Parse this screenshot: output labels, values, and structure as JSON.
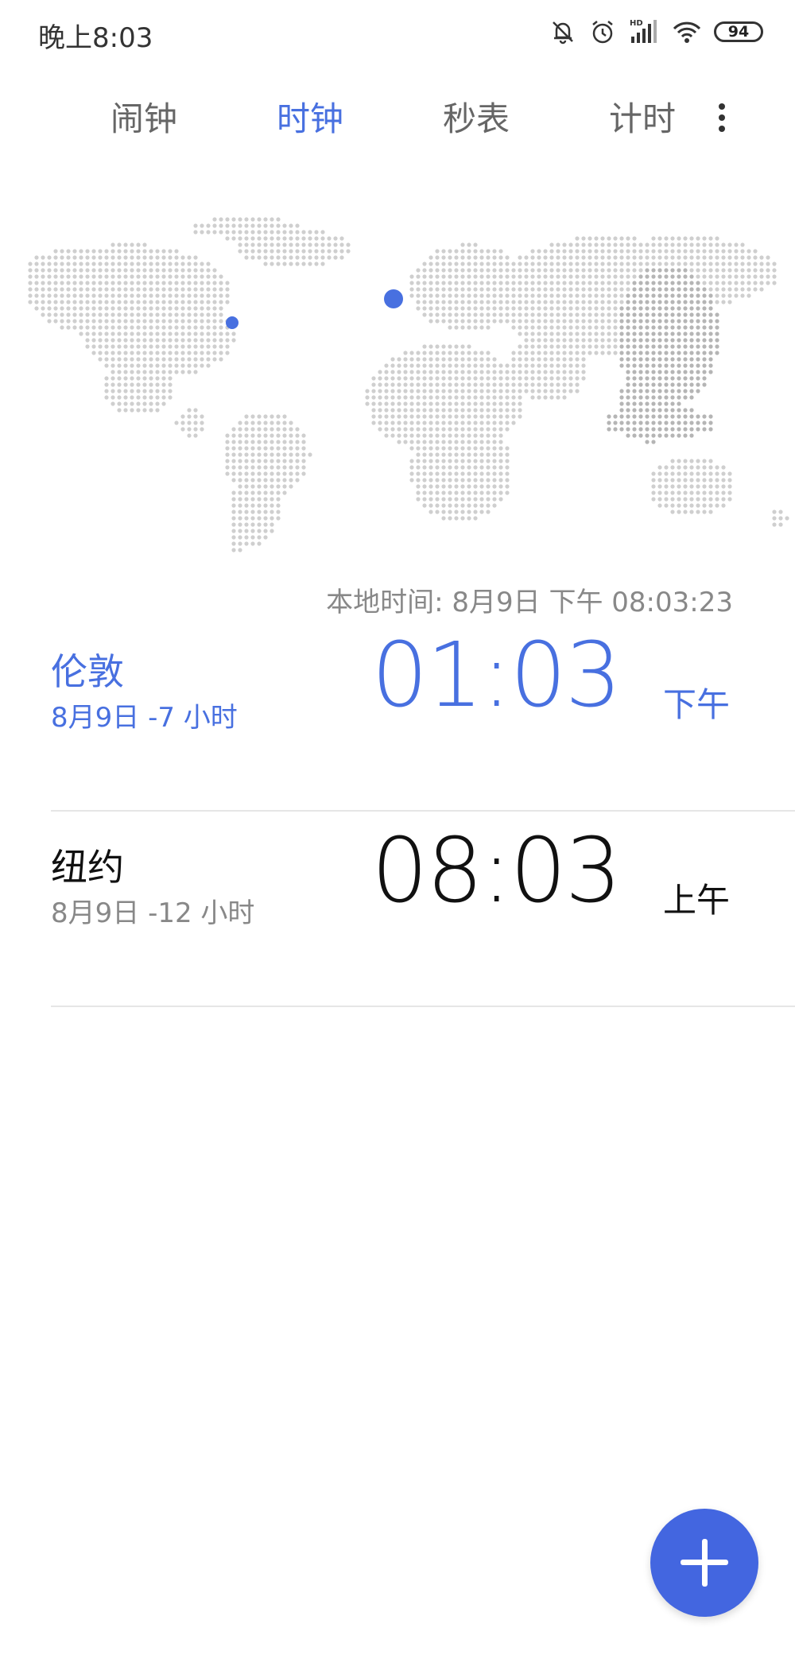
{
  "status_bar": {
    "time": "晚上8:03",
    "battery": "94",
    "icons": [
      "mute-bell-icon",
      "alarm-clock-icon",
      "hd-signal-icon",
      "wifi-icon",
      "battery-icon"
    ]
  },
  "tabs": [
    {
      "label": "闹钟",
      "active": false
    },
    {
      "label": "时钟",
      "active": true
    },
    {
      "label": "秒表",
      "active": false
    },
    {
      "label": "计时",
      "active": false
    }
  ],
  "local_time": "本地时间: 8月9日  下午  08:03:23",
  "cities": [
    {
      "name": "伦敦",
      "sub": "8月9日 -7 小时",
      "time": "01:03",
      "ampm": "下午",
      "highlight": true
    },
    {
      "name": "纽约",
      "sub": "8月9日 -12 小时",
      "time": "08:03",
      "ampm": "上午",
      "highlight": false
    }
  ],
  "fab": {
    "icon": "plus-icon"
  },
  "colors": {
    "accent": "#4870e0",
    "fab": "#4366e0",
    "map_dot": "#cfcfcf",
    "map_dot_asia": "#b5b5b5"
  }
}
